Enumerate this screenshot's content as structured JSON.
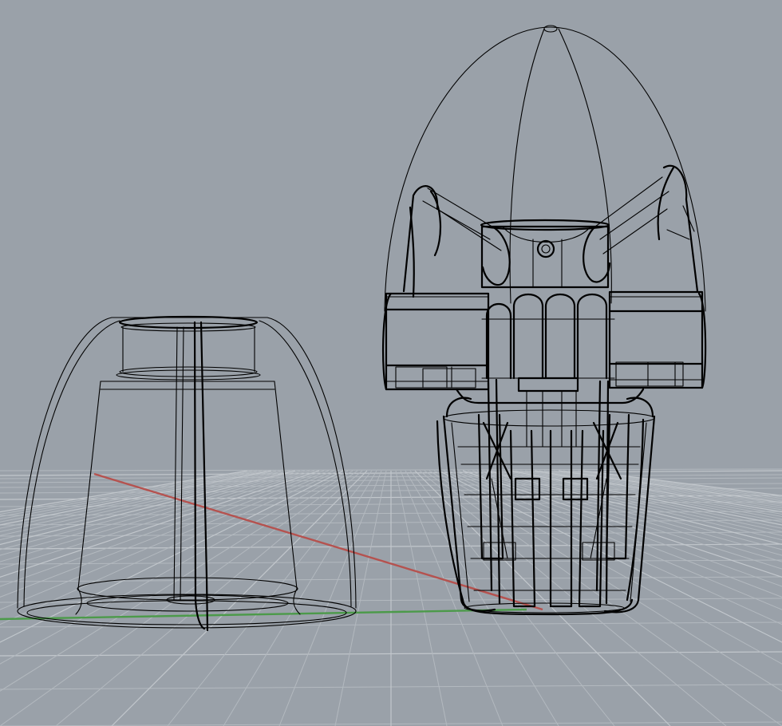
{
  "viewport": {
    "background": "#9aa1a9",
    "grid_color": "#b3b9bf",
    "wire_color": "#000000",
    "x_axis_color": "#b5524f",
    "y_axis_color": "#4c9a4a"
  },
  "objects": [
    "bell-shaped-cover",
    "mechanism-assembly"
  ]
}
